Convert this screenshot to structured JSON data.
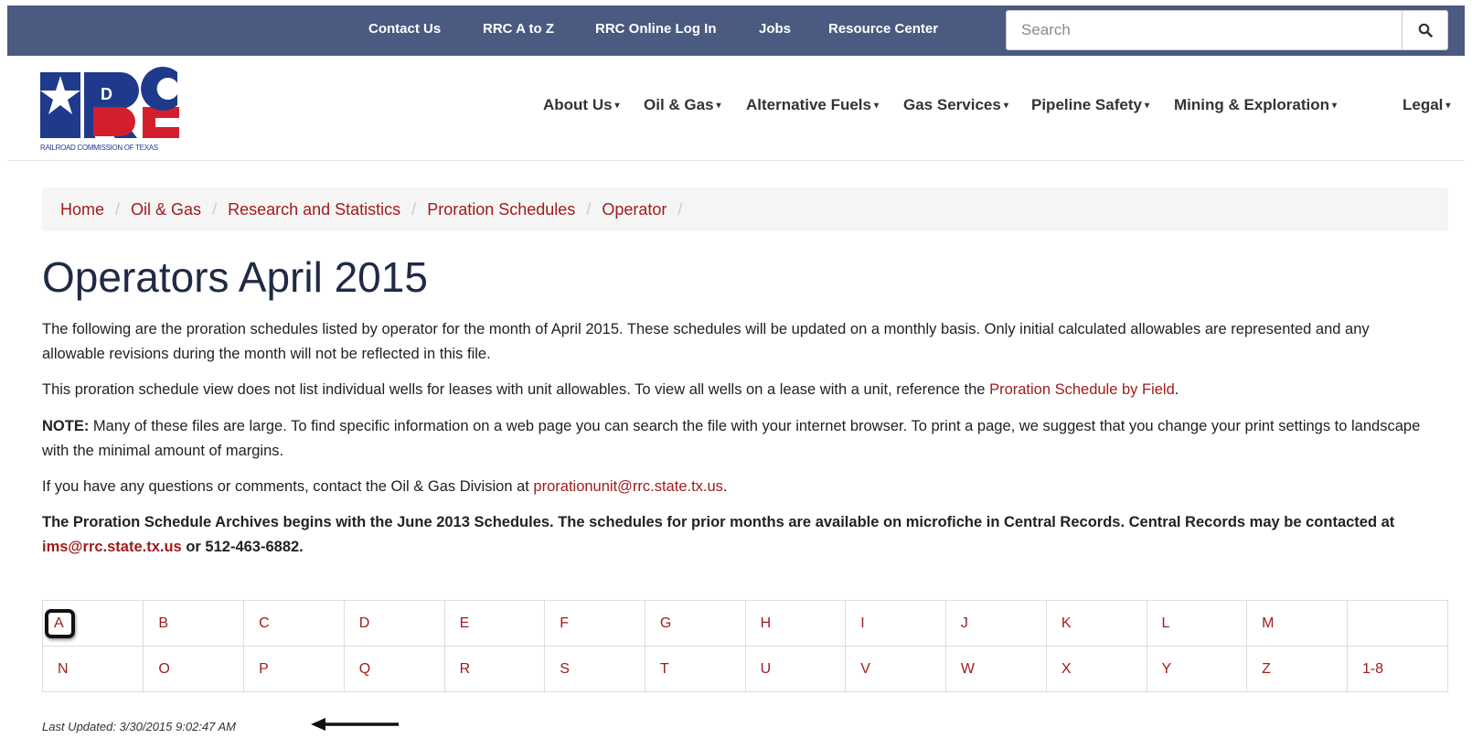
{
  "topbar": {
    "links": [
      "Contact Us",
      "RRC A to Z",
      "RRC Online Log In",
      "Jobs",
      "Resource Center"
    ],
    "search_placeholder": "Search",
    "search_icon": "search-icon"
  },
  "header": {
    "logo_caption": "RAILROAD COMMISSION OF TEXAS",
    "nav": [
      "About Us",
      "Oil & Gas",
      "Alternative Fuels",
      "Gas Services",
      "Pipeline Safety",
      "Mining & Exploration",
      "Legal"
    ]
  },
  "breadcrumb": [
    "Home",
    "Oil & Gas",
    "Research and Statistics",
    "Proration Schedules",
    "Operator"
  ],
  "page": {
    "title": "Operators April 2015",
    "p1": "The following are the proration schedules listed by operator for the month of April 2015. These schedules will be updated on a monthly basis. Only initial calculated allowables are represented and any allowable revisions during the month will not be reflected in this file.",
    "p2_text": "This proration schedule view does not list individual wells for leases with unit allowables. To view all wells on a lease with a unit, reference the ",
    "p2_link": "Proration Schedule by Field",
    "p3_label": "NOTE:",
    "p3_text": " Many of these files are large. To find specific information on a web page you can search the file with your internet browser. To print a page, we suggest that you change your print settings to landscape with the minimal amount of margins.",
    "p4_text": " If you have any questions or comments, contact the Oil & Gas Division at ",
    "p4_link": "prorationunit@rrc.state.tx.us",
    "p5_text": "The Proration Schedule Archives begins with the June 2013 Schedules. The schedules for prior months are available on microfiche in Central Records. Central Records may be contacted at ",
    "p5_link": "ims@rrc.state.tx.us",
    "p5_tail": " or 512-463-6882."
  },
  "alphabet": {
    "row1": [
      "A",
      "B",
      "C",
      "D",
      "E",
      "F",
      "G",
      "H",
      "I",
      "J",
      "K",
      "L",
      "M",
      ""
    ],
    "row2": [
      "N",
      "O",
      "P",
      "Q",
      "R",
      "S",
      "T",
      "U",
      "V",
      "W",
      "X",
      "Y",
      "Z",
      "1-8"
    ]
  },
  "last_updated": "Last Updated: 3/30/2015 9:02:47 AM",
  "colors": {
    "topbar": "#4a5a80",
    "link": "#a01c1c",
    "title": "#1f2a44"
  }
}
